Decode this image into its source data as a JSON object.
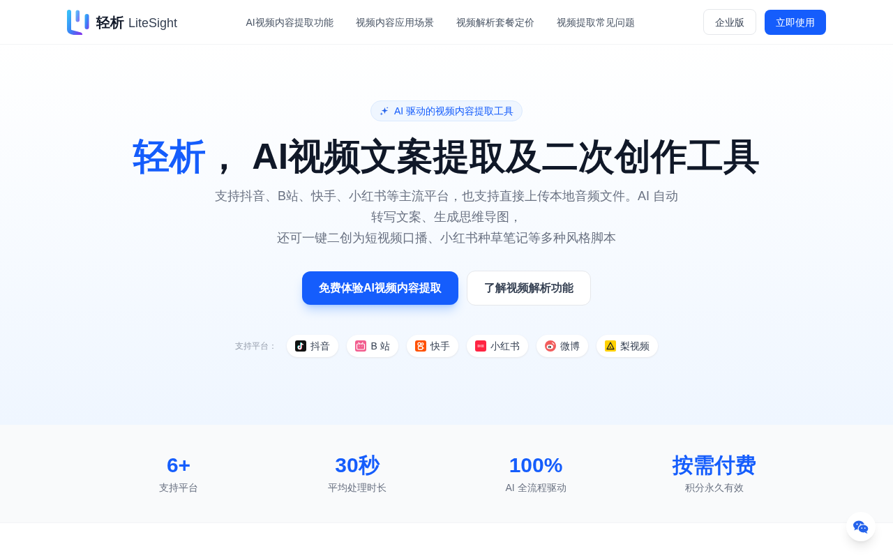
{
  "header": {
    "logo": {
      "name": "轻析",
      "name_latin": "LiteSight"
    },
    "nav": [
      "AI视频内容提取功能",
      "视频内容应用场景",
      "视频解析套餐定价",
      "视频提取常见问题"
    ],
    "buttons": [
      {
        "label": "企业版",
        "kind": "outline"
      },
      {
        "label": "立即使用",
        "kind": "primary"
      }
    ]
  },
  "hero": {
    "badge": "AI 驱动的视频内容提取工具",
    "title": {
      "highlight": "轻析",
      "rest": "， AI视频文案提取及二次创作工具"
    },
    "description_lines": [
      "支持抖音、B站、快手、小红书等主流平台，也支持直接上传本地音频文件。AI 自动",
      "转写文案、生成思维导图，",
      "还可一键二创为短视频口播、小红书种草笔记等多种风格脚本"
    ],
    "buttons": [
      {
        "label": "免费体验AI视频内容提取",
        "kind": "primary"
      },
      {
        "label": "了解视频解析功能",
        "kind": "outline"
      }
    ],
    "platforms": {
      "label": "支持平台：",
      "items": [
        {
          "name": "抖音",
          "kind": "douyin"
        },
        {
          "name": "B 站",
          "kind": "bilibili"
        },
        {
          "name": "快手",
          "kind": "kuaishou"
        },
        {
          "name": "小红书",
          "kind": "xiaohongshu"
        },
        {
          "name": "微博",
          "kind": "weibo"
        },
        {
          "name": "梨视频",
          "kind": "pear"
        }
      ]
    }
  },
  "stats": [
    {
      "value": "6+",
      "label": "支持平台"
    },
    {
      "value": "30秒",
      "label": "平均处理时长"
    },
    {
      "value": "100%",
      "label": "AI 全流程驱动"
    },
    {
      "value": "按需付费",
      "label": "积分永久有效"
    }
  ]
}
